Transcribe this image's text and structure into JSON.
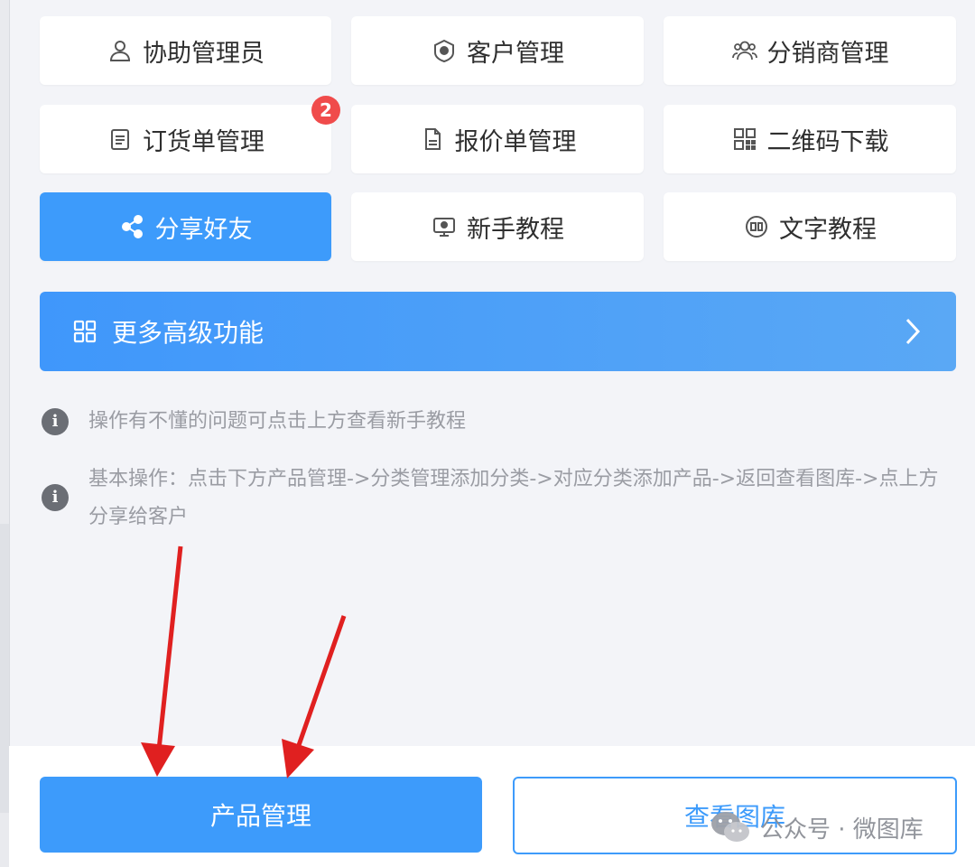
{
  "tiles": [
    {
      "label": "协助管理员",
      "icon": "person-icon"
    },
    {
      "label": "客户管理",
      "icon": "shield-icon"
    },
    {
      "label": "分销商管理",
      "icon": "group-icon"
    },
    {
      "label": "订货单管理",
      "icon": "clipboard-icon",
      "badge": "2"
    },
    {
      "label": "报价单管理",
      "icon": "document-icon"
    },
    {
      "label": "二维码下载",
      "icon": "qr-code-icon"
    },
    {
      "label": "分享好友",
      "icon": "share-icon",
      "active": true
    },
    {
      "label": "新手教程",
      "icon": "monitor-icon"
    },
    {
      "label": "文字教程",
      "icon": "text-tutorial-icon"
    }
  ],
  "more": {
    "label": "更多高级功能",
    "icon": "grid-icon",
    "chevron": "chevron-right-icon"
  },
  "notes": [
    "操作有不懂的问题可点击上方查看新手教程",
    "基本操作：点击下方产品管理->分类管理添加分类->对应分类添加产品->返回查看图库->点上方分享给客户"
  ],
  "buttons": {
    "primary": "产品管理",
    "secondary": "查看图库"
  },
  "watermark": "公众号 · 微图库",
  "colors": {
    "accent": "#3d9bfb",
    "badge": "#f04b4b",
    "arrow": "#e02020"
  }
}
